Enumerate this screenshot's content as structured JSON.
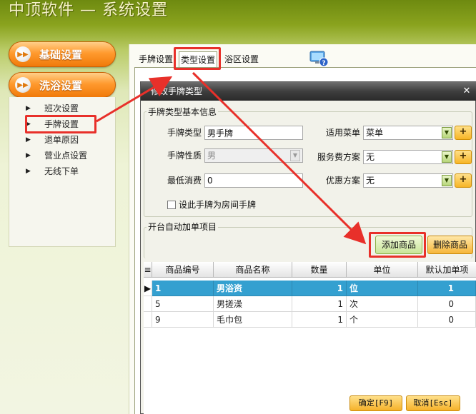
{
  "app": {
    "title": "中顶软件 — 系统设置"
  },
  "sidebar": {
    "sections": [
      {
        "label": "基础设置"
      },
      {
        "label": "洗浴设置"
      }
    ],
    "items": [
      {
        "label": "班次设置"
      },
      {
        "label": "手牌设置"
      },
      {
        "label": "退单原因"
      },
      {
        "label": "营业点设置"
      },
      {
        "label": "无线下单"
      }
    ]
  },
  "tabs": [
    {
      "label": "手牌设置"
    },
    {
      "label": "类型设置"
    },
    {
      "label": "浴区设置"
    }
  ],
  "dialog": {
    "title": "修改手牌类型",
    "basic_group": "手牌类型基本信息",
    "fields": {
      "type_label": "手牌类型",
      "type_value": "男手牌",
      "nature_label": "手牌性质",
      "nature_value": "男",
      "min_label": "最低消费",
      "min_value": "0",
      "menu_label": "适用菜单",
      "menu_value": "菜单",
      "service_label": "服务费方案",
      "service_value": "无",
      "discount_label": "优惠方案",
      "discount_value": "无",
      "room_checkbox_label": "设此手牌为房间手牌"
    },
    "auto_group": "开台自动加单项目",
    "add_button": "添加商品",
    "delete_button": "删除商品",
    "grid": {
      "columns": [
        "商品编号",
        "商品名称",
        "数量",
        "单位",
        "默认加单项"
      ],
      "rows": [
        {
          "code": "1",
          "name": "男浴资",
          "qty": "1",
          "unit": "位",
          "default": "1"
        },
        {
          "code": "5",
          "name": "男搓澡",
          "qty": "1",
          "unit": "次",
          "default": "0"
        },
        {
          "code": "9",
          "name": "毛巾包",
          "qty": "1",
          "unit": "个",
          "default": "0"
        }
      ]
    },
    "ok_button": "确定[F9]",
    "cancel_button": "取消[Esc]"
  },
  "icons": {
    "tab_help": "monitor-help-icon",
    "expand": "play-circle-icon",
    "close": "close-icon"
  },
  "colors": {
    "accent_orange": "#f59020",
    "highlight_red": "#e8302a",
    "selected_row": "#34a0d0",
    "titlebar": "#3a3a3a"
  }
}
